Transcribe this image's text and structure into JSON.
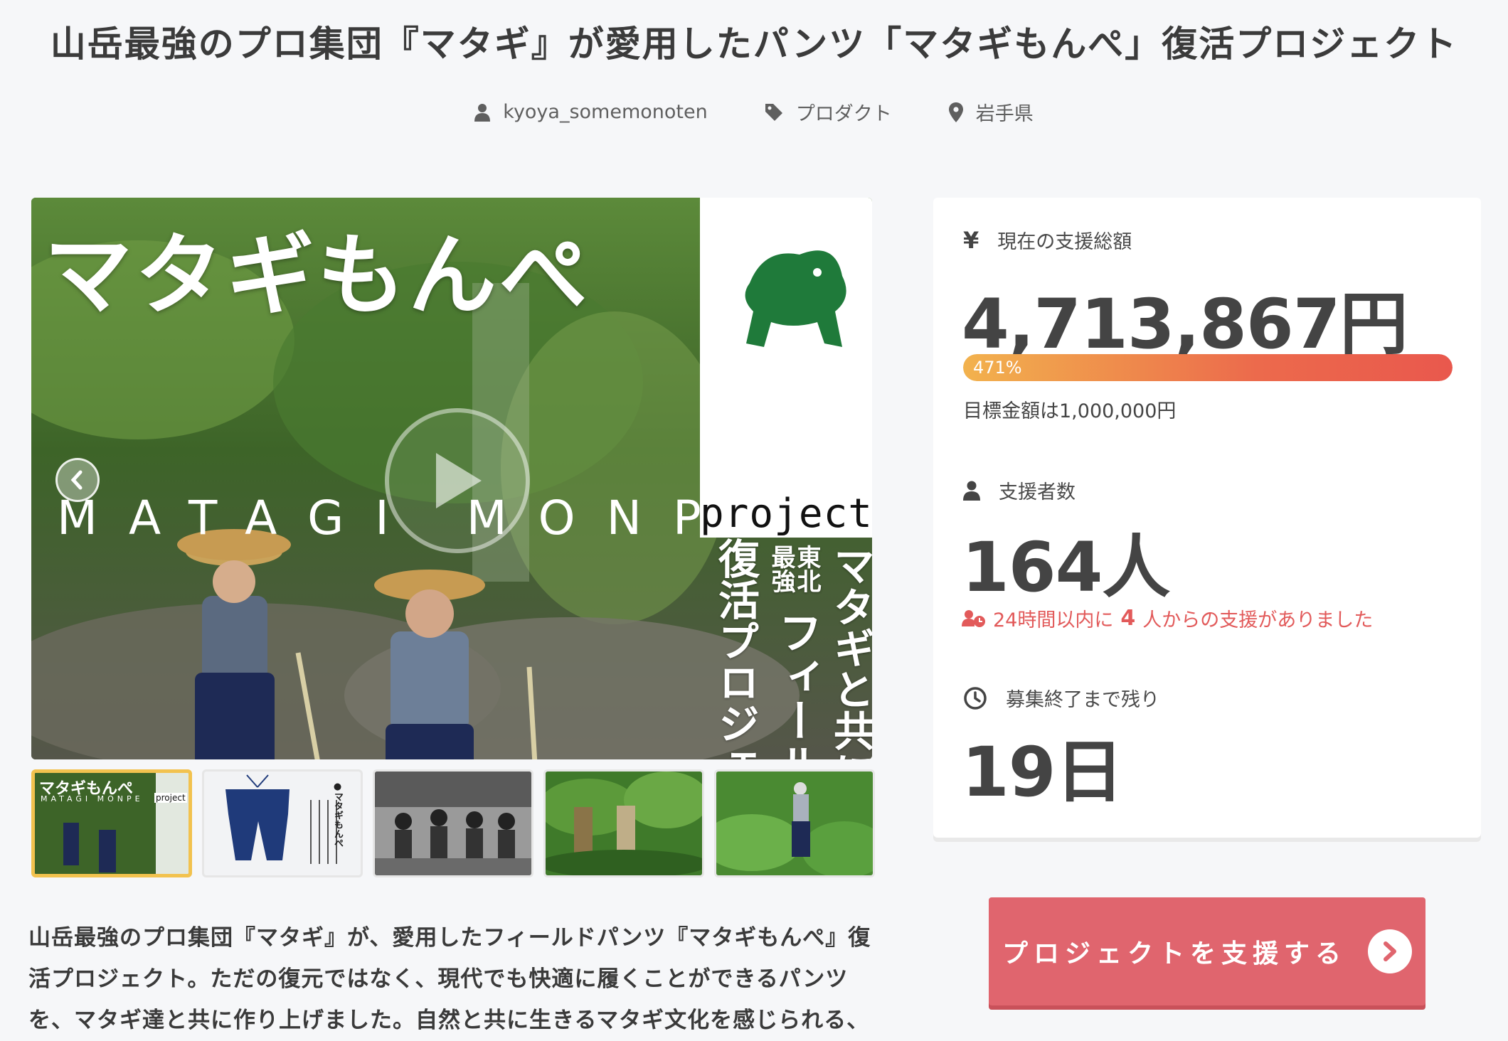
{
  "title": "山岳最強のプロ集団『マタギ』が愛用したパンツ「マタギもんぺ」復活プロジェクト",
  "meta": {
    "author": "kyoya_somemonoten",
    "category": "プロダクト",
    "location": "岩手県"
  },
  "hero": {
    "title_jp": "マタギもんぺ",
    "title_latin": "MATAGI MONPE",
    "project_word": "project",
    "vertical_small_1": "東北",
    "vertical_small_2": "最強",
    "vertical_col_a": "マタギと共に作る",
    "vertical_col_b": "フィールドパンツ",
    "vertical_col_c": "復活プロジェクト"
  },
  "thumbs": {
    "t1_title": "マタギもんぺ",
    "t1_latin": "MATAGI MONPE",
    "t1_project": "project",
    "t2_heading": "●マタギもんぺ"
  },
  "description": "山岳最強のプロ集団『マタギ』が、愛用したフィールドパンツ『マタギもんぺ』復活プロジェクト。ただの復元ではなく、現代でも快適に履くことができるパンツを、マタギ達と共に作り上げました。自然と共に生きるマタギ文化を感じられる、",
  "stats": {
    "amount_label": "現在の支援総額",
    "amount": "4,713,867円",
    "progress_percent": 471,
    "progress_text": "471%",
    "goal_text": "目標金額は1,000,000円",
    "backers_label": "支援者数",
    "backers": "164人",
    "recent_prefix": "24時間以内に",
    "recent_count": "4",
    "recent_suffix": "人からの支援がありました",
    "remaining_label": "募集終了まで残り",
    "remaining": "19日"
  },
  "support_button": "プロジェクトを支援する",
  "colors": {
    "accent": "#e0656e",
    "progress_start": "#f2b24d",
    "progress_end": "#e9584d",
    "thumb_active_border": "#f2c24e",
    "alert": "#e25a5a"
  }
}
